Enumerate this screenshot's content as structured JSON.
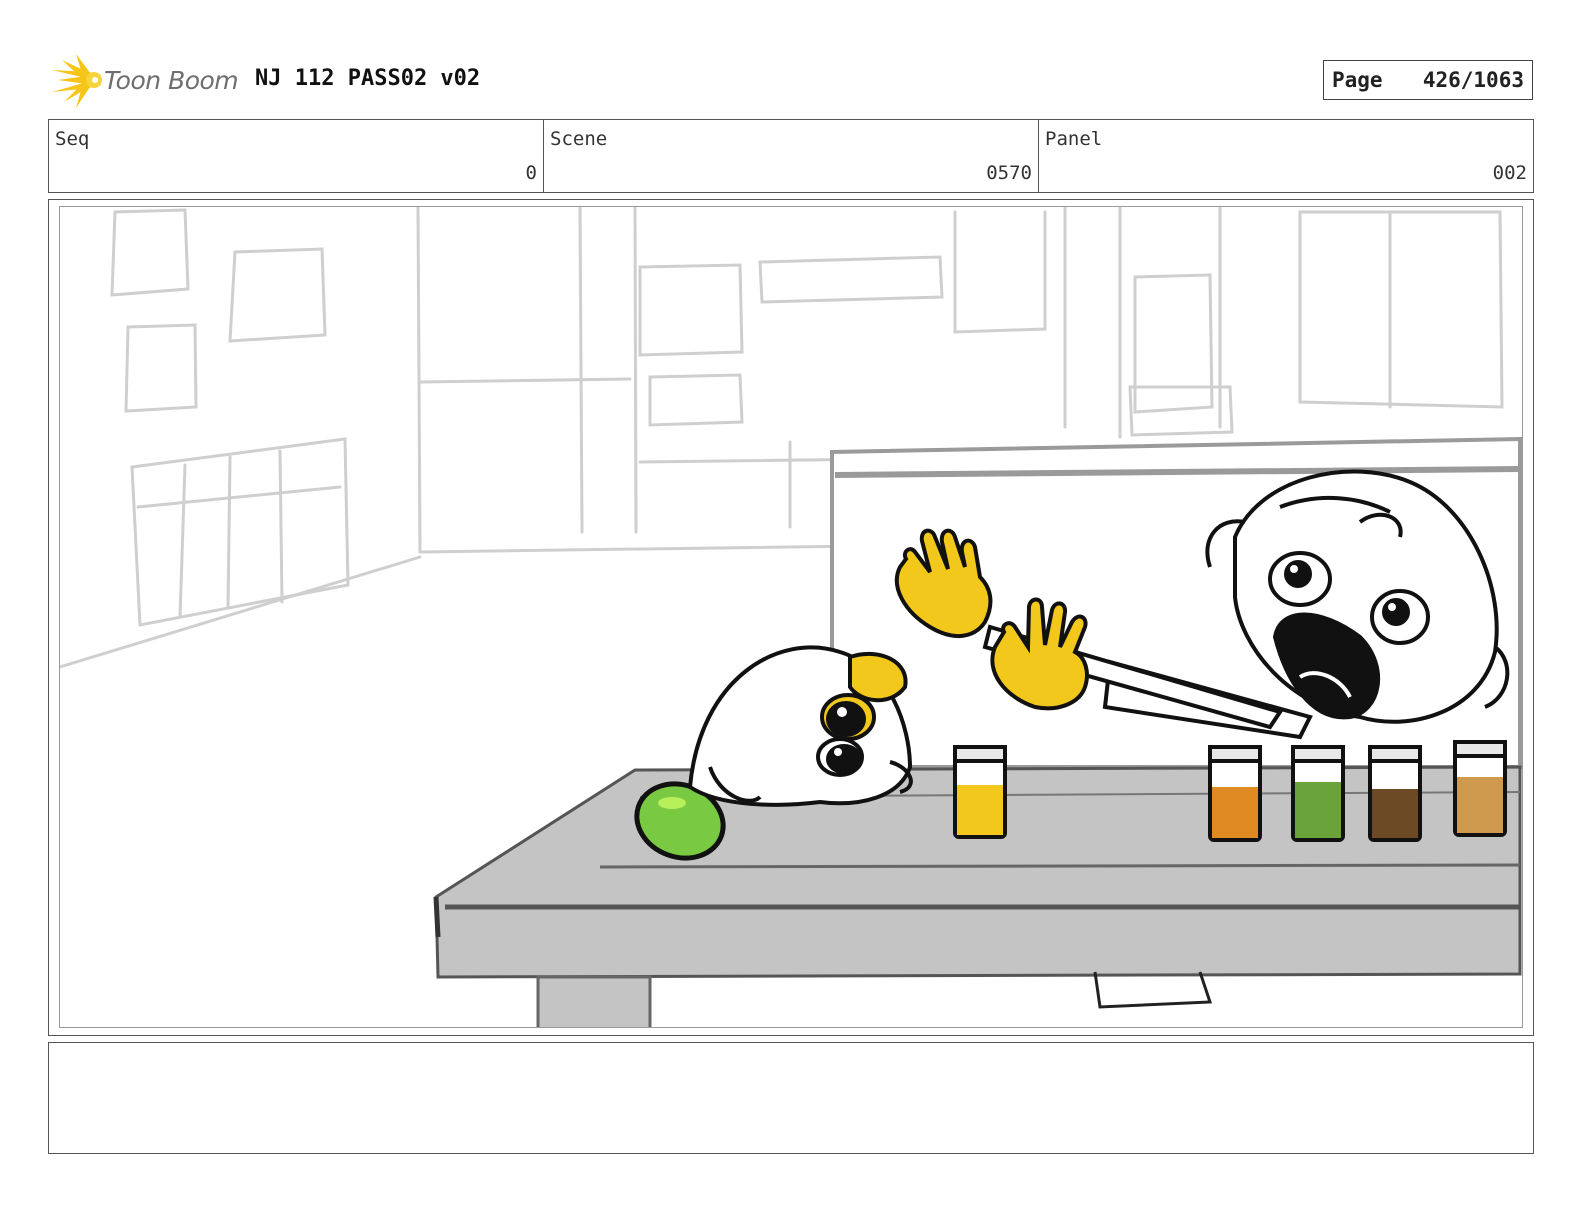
{
  "header": {
    "logo_text": "Toon Boom",
    "title": "NJ 112 PASS02 v02",
    "page_label": "Page",
    "page_value": "426/1063"
  },
  "info": {
    "seq_label": "Seq",
    "seq_value": "0",
    "scene_label": "Scene",
    "scene_value": "0570",
    "panel_label": "Panel",
    "panel_value": "002"
  },
  "notes": {
    "text": ""
  },
  "colors": {
    "logo_yellow": "#f5c518",
    "jar_yellow": "#f3c81c",
    "jar_orange": "#df8a22",
    "jar_green": "#6aa33a",
    "jar_brown": "#6b4a25",
    "jar_tan": "#d09a4e",
    "avocado_green": "#7ac943",
    "table_gray": "#c4c4c4"
  }
}
